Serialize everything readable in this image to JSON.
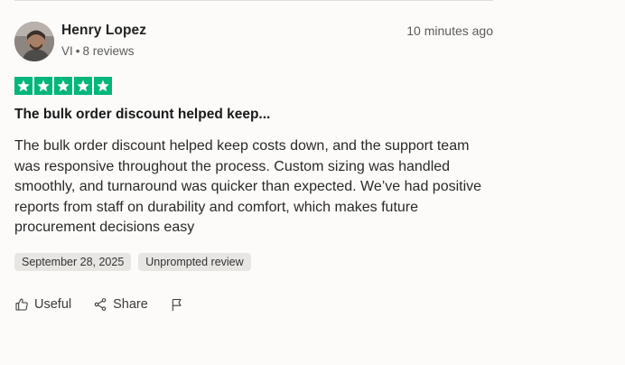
{
  "review": {
    "author": "Henry Lopez",
    "country": "VI",
    "reviews_count": "8 reviews",
    "time_ago": "10 minutes ago",
    "rating": 5,
    "star_color": "#00b67a",
    "title": "The bulk order discount helped keep...",
    "body": "The bulk order discount helped keep costs down, and the support team was responsive throughout the process. Custom sizing was handled smoothly, and turnaround was quicker than expected. We’ve had positive reports from staff on durability and comfort, which makes future procurement decisions easy",
    "date_tag": "September 28, 2025",
    "prompt_tag": "Unprompted review"
  },
  "actions": {
    "useful_label": "Useful",
    "share_label": "Share"
  },
  "icons": {
    "useful": "thumbs-up-icon",
    "share": "share-icon",
    "report": "flag-icon",
    "star": "star-icon"
  }
}
